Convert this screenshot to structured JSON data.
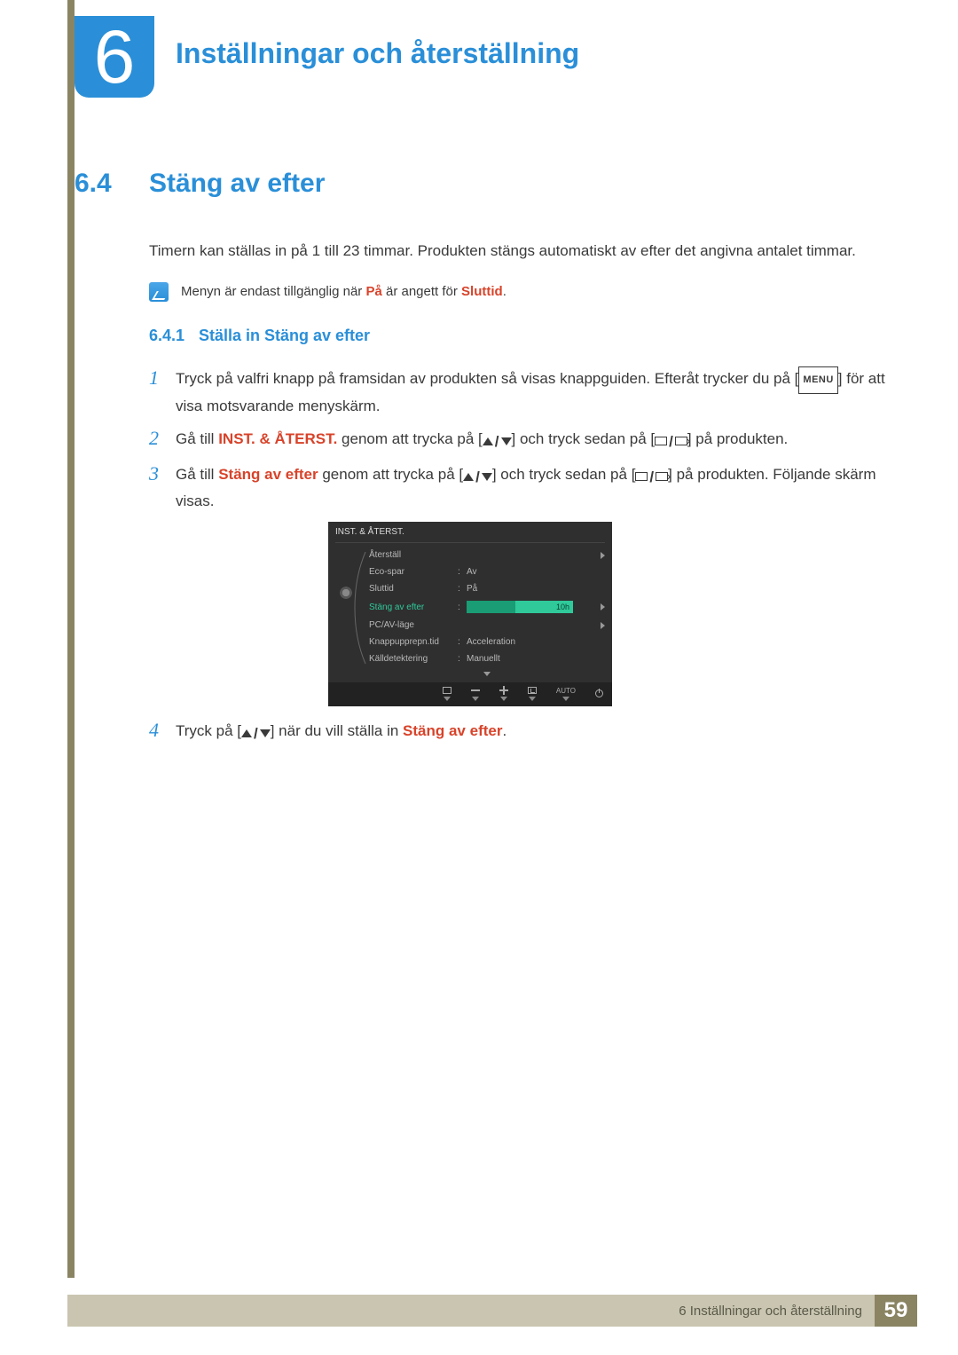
{
  "chapter": {
    "number": "6",
    "title": "Inställningar och återställning"
  },
  "section": {
    "number": "6.4",
    "title": "Stäng av efter",
    "intro": "Timern kan ställas in på 1 till 23 timmar. Produkten stängs automatiskt av efter det angivna antalet timmar."
  },
  "note": {
    "pre": "Menyn är endast tillgänglig när ",
    "hl1": "På",
    "mid": " är angett för ",
    "hl2": "Sluttid",
    "post": "."
  },
  "subsection": {
    "number": "6.4.1",
    "title": "Ställa in Stäng av efter"
  },
  "steps": {
    "s1": {
      "pre": "Tryck på valfri knapp på framsidan av produkten så visas knappguiden. Efteråt trycker du på [",
      "menu": "MENU",
      "post": "] för att visa motsvarande menyskärm."
    },
    "s2": {
      "pre": "Gå till ",
      "hl": "INST. & ÅTERST.",
      "mid": " genom att trycka på [",
      "mid2": "] och tryck sedan på [",
      "post": "] på produkten."
    },
    "s3": {
      "pre": "Gå till ",
      "hl": "Stäng av efter",
      "mid": " genom att trycka på [",
      "mid2": "] och tryck sedan på [",
      "post": "] på produkten. Följande skärm visas."
    },
    "s4": {
      "pre": "Tryck på [",
      "mid": "] när du vill ställa in ",
      "hl": "Stäng av efter",
      "post": "."
    }
  },
  "osd": {
    "title": "INST. & ÅTERST.",
    "items": [
      {
        "label": "Återställ",
        "value": ""
      },
      {
        "label": "Eco-spar",
        "value": "Av"
      },
      {
        "label": "Sluttid",
        "value": "På"
      },
      {
        "label": "Stäng av efter",
        "value": "10h",
        "selected": true,
        "slider": true
      },
      {
        "label": "PC/AV-läge",
        "value": ""
      },
      {
        "label": "Knappupprepn.tid",
        "value": "Acceleration"
      },
      {
        "label": "Källdetektering",
        "value": "Manuellt"
      }
    ],
    "auto": "AUTO"
  },
  "footer": {
    "text": "6 Inställningar och återställning",
    "page": "59"
  }
}
